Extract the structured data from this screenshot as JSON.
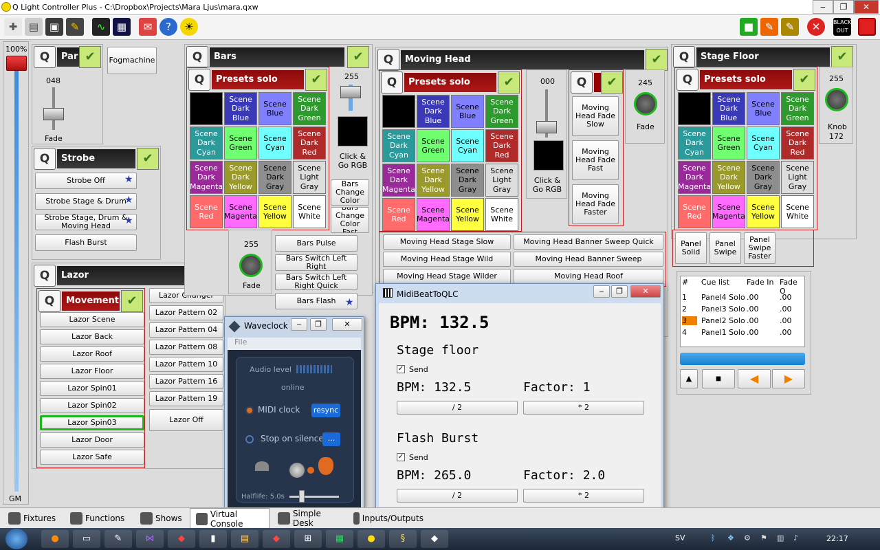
{
  "window": {
    "title": "Q Light Controller Plus - C:\\Dropbox\\Projects\\Mara Ljus\\mara.qxw"
  },
  "toolbar": {
    "blackout": "BLACK OUT"
  },
  "grandmaster": {
    "level": "100%",
    "label": "GM"
  },
  "par": {
    "title": "Par",
    "fader_value": "048",
    "fader_label": "Fade",
    "fogmachine": "Fogmachine"
  },
  "strobe": {
    "title": "Strobe",
    "buttons": [
      "Strobe Off",
      "Strobe Stage & Drum",
      "Strobe Stage, Drum & Moving Head",
      "Flash Burst"
    ]
  },
  "lazor": {
    "title": "Lazor",
    "movement_title": "Movement",
    "movement_buttons": [
      "Lazor Scene",
      "Lazor Back",
      "Lazor Roof",
      "Lazor Floor",
      "Lazor Spin01",
      "Lazor Spin02",
      "Lazor Spin03",
      "Lazor Door",
      "Lazor Safe"
    ],
    "patterns": [
      "Lazor Changer",
      "Lazor Pattern 02",
      "Lazor Pattern 04",
      "Lazor Pattern 08",
      "Lazor Pattern 10",
      "Lazor Pattern 16",
      "Lazor Pattern 19"
    ],
    "off": "Lazor Off"
  },
  "scenes": [
    "",
    "Scene Dark Blue",
    "Scene Blue",
    "Scene Dark Green",
    "Scene Dark Cyan",
    "Scene Green",
    "Scene Cyan",
    "Scene Dark Red",
    "Scene Dark Magenta",
    "Scene Dark Yellow",
    "Scene Dark Gray",
    "Scene Light Gray",
    "Scene Red",
    "Scene Magenta",
    "Scene Yellow",
    "Scene White"
  ],
  "scene_colors": [
    "#000000",
    "#3a3ab8",
    "#8080ff",
    "#2e9a2e",
    "#2a9a9a",
    "#70ff70",
    "#70ffff",
    "#b02a2a",
    "#9a2a9a",
    "#9a9a2a",
    "#8e8e8e",
    "#dddddd",
    "#ff6a6a",
    "#ff6aff",
    "#ffff40",
    "#ffffff"
  ],
  "presets_title": "Presets solo frame",
  "bars": {
    "title": "Bars",
    "fader_value": "255",
    "click_label": "Click & Go RGB",
    "change_color": "Bars Change Color",
    "change_color_fast": "Bars Change Color Fast",
    "knob_value": "255",
    "knob_label": "Fade",
    "buttons": [
      "Bars Pulse",
      "Bars Switch Left Right",
      "Bars Switch Left Right Quick",
      "Bars Flash"
    ]
  },
  "moving_head": {
    "title": "Moving Head",
    "fader_value": "000",
    "click_label": "Click & Go RGB",
    "fade_buttons": [
      "Moving Head Fade Slow",
      "Moving Head Fade Fast",
      "Moving Head Fade Faster"
    ],
    "knob_value": "245",
    "knob_label": "Fade",
    "stage_buttons": [
      "Moving Head Stage Slow",
      "Moving Head Stage Wild",
      "Moving Head Stage Wilder"
    ],
    "banner_buttons": [
      "Moving Head Banner Sweep Quick",
      "Moving Head Banner Sweep",
      "Moving Head Roof"
    ]
  },
  "stage_floor": {
    "title": "Stage Floor",
    "knob_value": "255",
    "knob_label": "Knob",
    "knob_sub": "172",
    "panels": [
      "Panel Solid",
      "Panel Swipe",
      "Panel Swipe Faster"
    ]
  },
  "cuelist": {
    "headers": [
      "#",
      "Cue list",
      "Fade In",
      "Fade O"
    ],
    "rows": [
      [
        "1",
        "Panel4 Solo",
        ".00",
        ".00"
      ],
      [
        "2",
        "Panel3 Solo",
        ".00",
        ".00"
      ],
      [
        "3",
        "Panel2 Solo",
        ".00",
        ".00"
      ],
      [
        "4",
        "Panel1 Solo",
        ".00",
        ".00"
      ]
    ]
  },
  "waveclock": {
    "title": "Waveclock",
    "menu": "File",
    "audio_level": "Audio level",
    "status": "online",
    "midi_clock": "MIDI clock",
    "resync": "resync",
    "stop_on_silence": "Stop on silence",
    "dots": "...",
    "halflife": "Halflife: 5.0s"
  },
  "midibeat": {
    "title": "MidiBeatToQLC",
    "bpm": "BPM: 132.5",
    "sections": [
      {
        "name": "Stage floor",
        "send": "Send",
        "bpm": "BPM: 132.5",
        "factor": "Factor: 1",
        "half": "/ 2",
        "double": "* 2"
      },
      {
        "name": "Flash Burst",
        "send": "Send",
        "bpm": "BPM: 265.0",
        "factor": "Factor: 2.0",
        "half": "/ 2",
        "double": "* 2"
      }
    ]
  },
  "tabs": [
    "Fixtures",
    "Functions",
    "Shows",
    "Virtual Console",
    "Simple Desk",
    "Inputs/Outputs"
  ],
  "taskbar": {
    "lang": "SV",
    "time": "22:17"
  }
}
